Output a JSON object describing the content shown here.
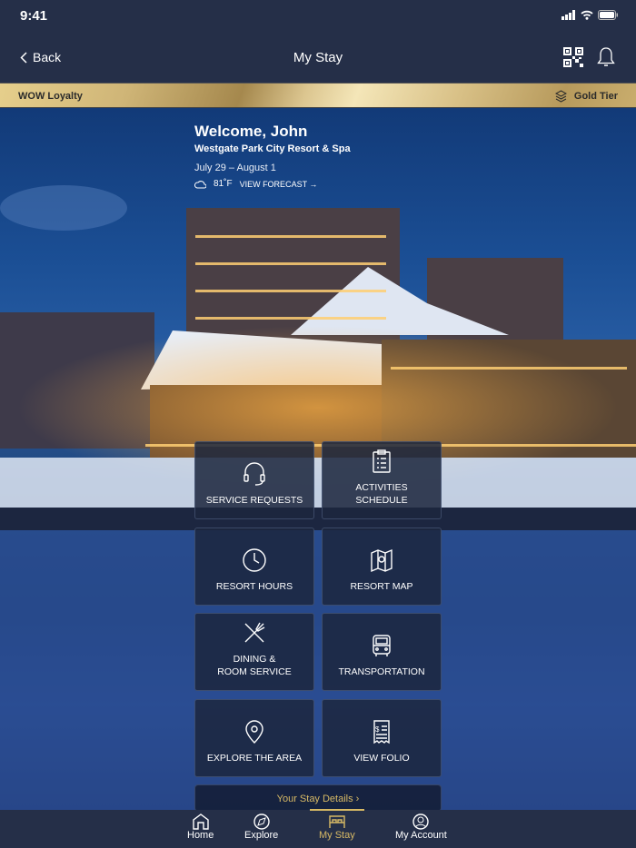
{
  "status": {
    "time": "9:41"
  },
  "nav": {
    "back": "Back",
    "title": "My Stay"
  },
  "loyalty": {
    "program": "WOW Loyalty",
    "tier": "Gold Tier"
  },
  "welcome": {
    "greeting": "Welcome, John",
    "resort": "Westgate Park City Resort & Spa",
    "dates": "July 29 – August 1",
    "temperature": "81˚F",
    "forecast": "VIEW FORECAST →"
  },
  "tiles": [
    {
      "label": "SERVICE REQUESTS",
      "icon": "headset-icon"
    },
    {
      "label": "ACTIVITIES\nSCHEDULE",
      "icon": "clipboard-icon"
    },
    {
      "label": "RESORT HOURS",
      "icon": "clock-icon"
    },
    {
      "label": "RESORT MAP",
      "icon": "map-icon"
    },
    {
      "label": "DINING &\nROOM SERVICE",
      "icon": "utensils-icon"
    },
    {
      "label": "TRANSPORTATION",
      "icon": "bus-icon"
    },
    {
      "label": "EXPLORE THE AREA",
      "icon": "location-pin-icon"
    },
    {
      "label": "VIEW FOLIO",
      "icon": "receipt-icon"
    }
  ],
  "stay_details": "Your Stay Details ›",
  "tabs": [
    {
      "label": "Home"
    },
    {
      "label": "Explore"
    },
    {
      "label": "My Stay"
    },
    {
      "label": "My Account"
    }
  ],
  "colors": {
    "gold": "#d7b965",
    "navy": "#252f48"
  }
}
